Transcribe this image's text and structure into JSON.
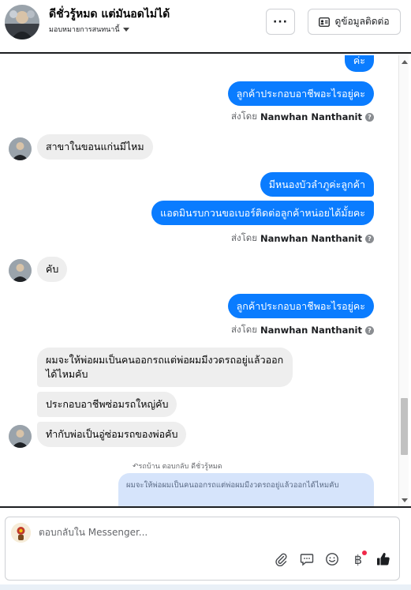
{
  "header": {
    "contact_name": "ดีชั่วรู้หมด แต่มันอดไม่ได้",
    "assignee": "มอบหมายการสนทนานี้",
    "more_label": "···",
    "contact_info_label": "ดูข้อมูลติดต่อ"
  },
  "messages": [
    {
      "side": "out",
      "text": "ค่ะ"
    },
    {
      "side": "out",
      "text": "ลูกค้าประกอบอาชีพอะไรอยู่คะ"
    },
    {
      "side": "meta",
      "prefix": "ส่งโดย",
      "name": "Nanwhan Nanthanit"
    },
    {
      "side": "in",
      "text": "สาขาในขอนแก่นมีไหม"
    },
    {
      "side": "out",
      "text": "มีหนองบัวลำภูค่ะลูกค้า"
    },
    {
      "side": "out",
      "text": "แอดมินรบกวนขอเบอร์ติดต่อลูกค้าหน่อยได้มั้ยคะ"
    },
    {
      "side": "meta",
      "prefix": "ส่งโดย",
      "name": "Nanwhan Nanthanit"
    },
    {
      "side": "in",
      "text": "คับ"
    },
    {
      "side": "out",
      "text": "ลูกค้าประกอบอาชีพอะไรอยู่คะ"
    },
    {
      "side": "meta",
      "prefix": "ส่งโดย",
      "name": "Nanwhan Nanthanit"
    },
    {
      "side": "in",
      "text": "ผมจะให้พ่อผมเป็นคนออกรถแต่พ่อผมมีงวดรถอยู่แล้วออกได้ไหมคับ"
    },
    {
      "side": "in",
      "text": "ประกอบอาชีพซ่อมรถใหญ่คับ"
    },
    {
      "side": "in",
      "text": "ทำกับพ่อเป็นอู่ซ่อมรถของพ่อคับ"
    }
  ],
  "reply": {
    "label": "↶รถบ้าน ตอบกลับ ดีชั่วรู้หมด",
    "preview": "ผมจะให้พ่อผมเป็นคนออกรถแต่พ่อผมมีงวดรถอยู่แล้วออกได้ไหมคับ"
  },
  "composer": {
    "placeholder": "ตอบกลับใน Messenger...",
    "tools": [
      "paperclip-icon",
      "saved-reply-icon",
      "emoji-icon",
      "baht-icon",
      "thumbs-up-icon"
    ],
    "baht_symbol": "฿"
  },
  "colors": {
    "outgoing_bubble": "#0a7cff",
    "incoming_bubble": "#eeeeee",
    "reply_preview": "#d6e4fb",
    "notification_dot": "#f02849"
  }
}
